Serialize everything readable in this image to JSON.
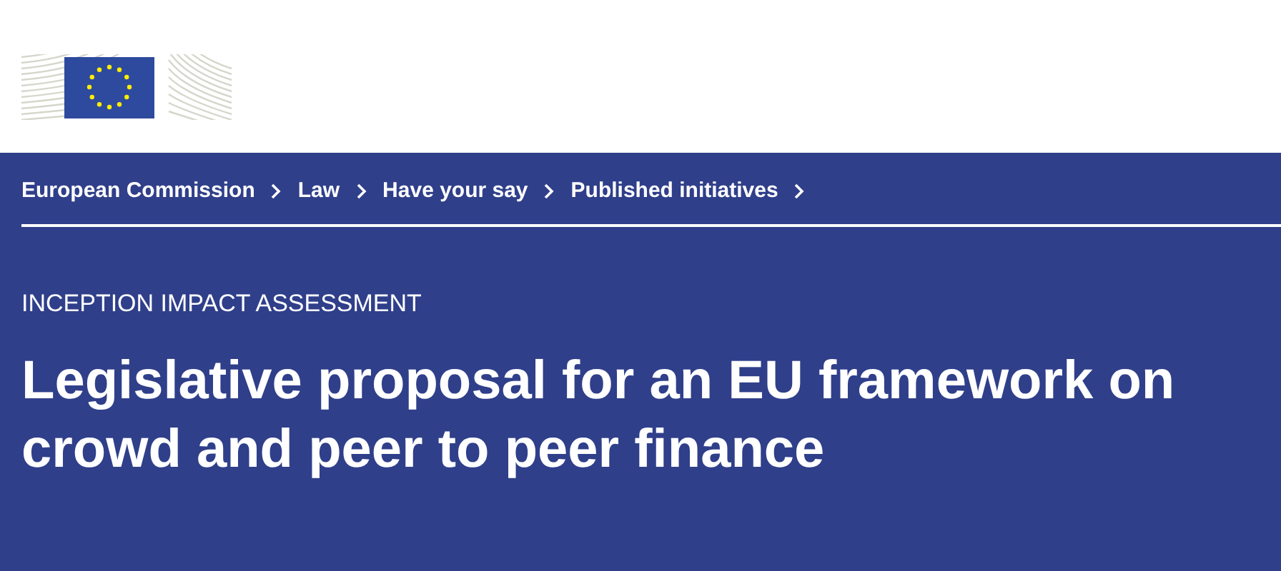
{
  "breadcrumb": [
    {
      "label": "European Commission"
    },
    {
      "label": "Law"
    },
    {
      "label": "Have your say"
    },
    {
      "label": "Published initiatives"
    }
  ],
  "page": {
    "kicker": "INCEPTION IMPACT ASSESSMENT",
    "title": "Legislative proposal for an EU framework on crowd and peer to peer finance"
  }
}
